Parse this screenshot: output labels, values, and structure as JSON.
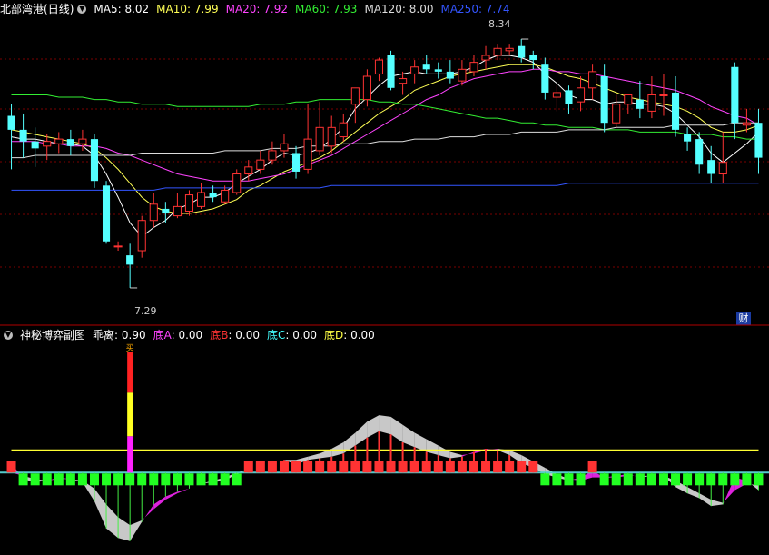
{
  "header": {
    "stock_name": "北部湾港",
    "period": "(日线)",
    "ma": [
      {
        "label": "MA5",
        "value": "8.02",
        "color": "#ffffff"
      },
      {
        "label": "MA10",
        "value": "7.99",
        "color": "#ffff55"
      },
      {
        "label": "MA20",
        "value": "7.92",
        "color": "#ff44ff"
      },
      {
        "label": "MA60",
        "value": "7.93",
        "color": "#33ee33"
      },
      {
        "label": "MA120",
        "value": "8.00",
        "color": "#dddddd"
      },
      {
        "label": "MA250",
        "value": "7.74",
        "color": "#3355ff"
      }
    ]
  },
  "sub_header": {
    "title": "神秘博弈副图",
    "items": [
      {
        "label": "乖离",
        "value": "0.90",
        "color": "#ffffff"
      },
      {
        "label": "底A",
        "value": "0.00",
        "color": "#ff44ff"
      },
      {
        "label": "底B",
        "value": "0.00",
        "color": "#ff3333"
      },
      {
        "label": "底C",
        "value": "0.00",
        "color": "#44ffff"
      },
      {
        "label": "底D",
        "value": "0.00",
        "color": "#ffff44"
      }
    ]
  },
  "annotations": {
    "high": "8.34",
    "low": "7.29",
    "badge": "财",
    "buy_marker": "买"
  },
  "colors": {
    "up": "#ff3333",
    "down": "#54ffff",
    "grid": "#7a0000",
    "bg": "#000000"
  },
  "chart_data": [
    {
      "type": "candlestick",
      "ylim": [
        7.2,
        8.45
      ],
      "candles": [
        [
          8.03,
          7.97,
          8.08,
          7.8
        ],
        [
          7.97,
          7.92,
          8.04,
          7.85
        ],
        [
          7.92,
          7.89,
          7.98,
          7.81
        ],
        [
          7.9,
          7.92,
          7.95,
          7.84
        ],
        [
          7.91,
          7.93,
          7.96,
          7.87
        ],
        [
          7.93,
          7.9,
          7.97,
          7.86
        ],
        [
          7.91,
          7.93,
          7.97,
          7.88
        ],
        [
          7.93,
          7.75,
          7.95,
          7.72
        ],
        [
          7.73,
          7.49,
          7.75,
          7.48
        ],
        [
          7.47,
          7.47,
          7.49,
          7.45
        ],
        [
          7.43,
          7.39,
          7.48,
          7.29
        ],
        [
          7.45,
          7.58,
          7.6,
          7.42
        ],
        [
          7.58,
          7.65,
          7.7,
          7.55
        ],
        [
          7.63,
          7.61,
          7.66,
          7.57
        ],
        [
          7.6,
          7.64,
          7.7,
          7.59
        ],
        [
          7.62,
          7.69,
          7.71,
          7.6
        ],
        [
          7.64,
          7.7,
          7.74,
          7.63
        ],
        [
          7.7,
          7.68,
          7.73,
          7.66
        ],
        [
          7.66,
          7.71,
          7.73,
          7.65
        ],
        [
          7.7,
          7.78,
          7.8,
          7.69
        ],
        [
          7.78,
          7.81,
          7.84,
          7.75
        ],
        [
          7.8,
          7.84,
          7.88,
          7.78
        ],
        [
          7.84,
          7.88,
          7.92,
          7.82
        ],
        [
          7.88,
          7.91,
          7.95,
          7.85
        ],
        [
          7.87,
          7.79,
          7.9,
          7.76
        ],
        [
          7.8,
          7.93,
          8.08,
          7.78
        ],
        [
          7.88,
          7.98,
          8.09,
          7.86
        ],
        [
          7.9,
          7.98,
          8.03,
          7.87
        ],
        [
          7.94,
          8.0,
          8.04,
          7.92
        ],
        [
          8.08,
          8.15,
          8.15,
          8.0
        ],
        [
          8.1,
          8.2,
          8.23,
          8.07
        ],
        [
          8.21,
          8.27,
          8.28,
          8.18
        ],
        [
          8.29,
          8.15,
          8.31,
          8.14
        ],
        [
          8.17,
          8.19,
          8.22,
          8.12
        ],
        [
          8.21,
          8.24,
          8.27,
          8.17
        ],
        [
          8.25,
          8.23,
          8.29,
          8.21
        ],
        [
          8.23,
          8.22,
          8.26,
          8.19
        ],
        [
          8.22,
          8.19,
          8.27,
          8.17
        ],
        [
          8.18,
          8.23,
          8.27,
          8.16
        ],
        [
          8.22,
          8.26,
          8.29,
          8.2
        ],
        [
          8.27,
          8.29,
          8.33,
          8.23
        ],
        [
          8.29,
          8.32,
          8.34,
          8.27
        ],
        [
          8.31,
          8.32,
          8.34,
          8.29
        ],
        [
          8.33,
          8.28,
          8.36,
          8.26
        ],
        [
          8.29,
          8.27,
          8.31,
          8.23
        ],
        [
          8.25,
          8.13,
          8.28,
          8.1
        ],
        [
          8.11,
          8.13,
          8.16,
          8.05
        ],
        [
          8.14,
          8.08,
          8.16,
          8.04
        ],
        [
          8.09,
          8.15,
          8.2,
          8.05
        ],
        [
          8.15,
          8.22,
          8.25,
          8.1
        ],
        [
          8.2,
          8.0,
          8.25,
          7.96
        ],
        [
          8.0,
          8.08,
          8.12,
          7.98
        ],
        [
          8.08,
          8.12,
          8.12,
          8.04
        ],
        [
          8.1,
          8.06,
          8.18,
          8.02
        ],
        [
          8.05,
          8.12,
          8.2,
          8.02
        ],
        [
          8.12,
          8.12,
          8.21,
          8.03
        ],
        [
          8.13,
          7.97,
          8.2,
          7.94
        ],
        [
          7.95,
          7.92,
          7.98,
          7.88
        ],
        [
          7.93,
          7.82,
          7.96,
          7.78
        ],
        [
          7.84,
          7.78,
          7.9,
          7.74
        ],
        [
          7.78,
          7.83,
          7.96,
          7.74
        ],
        [
          8.24,
          8.0,
          8.26,
          7.93
        ],
        [
          7.99,
          8.0,
          8.06,
          7.96
        ],
        [
          8.0,
          7.85,
          8.06,
          7.78
        ]
      ],
      "ma": {
        "MA5": [
          7.94,
          7.93,
          7.93,
          7.92,
          7.91,
          7.91,
          7.9,
          7.86,
          7.78,
          7.68,
          7.57,
          7.51,
          7.55,
          7.58,
          7.63,
          7.65,
          7.68,
          7.68,
          7.7,
          7.74,
          7.77,
          7.8,
          7.84,
          7.87,
          7.86,
          7.87,
          7.89,
          7.93,
          7.98,
          8.06,
          8.11,
          8.16,
          8.2,
          8.21,
          8.22,
          8.21,
          8.21,
          8.21,
          8.22,
          8.24,
          8.27,
          8.29,
          8.29,
          8.28,
          8.26,
          8.21,
          8.17,
          8.12,
          8.1,
          8.1,
          8.08,
          8.09,
          8.09,
          8.08,
          8.08,
          8.07,
          8.04,
          7.99,
          7.94,
          7.87,
          7.83,
          7.87,
          7.91,
          7.96
        ],
        "MA10": [
          7.97,
          7.96,
          7.95,
          7.94,
          7.93,
          7.92,
          7.91,
          7.89,
          7.85,
          7.8,
          7.74,
          7.68,
          7.64,
          7.62,
          7.61,
          7.61,
          7.62,
          7.63,
          7.65,
          7.67,
          7.71,
          7.73,
          7.76,
          7.79,
          7.81,
          7.83,
          7.85,
          7.88,
          7.92,
          7.96,
          8.0,
          8.04,
          8.07,
          8.1,
          8.14,
          8.16,
          8.18,
          8.2,
          8.21,
          8.22,
          8.23,
          8.24,
          8.25,
          8.25,
          8.25,
          8.24,
          8.22,
          8.2,
          8.19,
          8.17,
          8.15,
          8.13,
          8.11,
          8.1,
          8.09,
          8.08,
          8.07,
          8.05,
          8.02,
          7.98,
          7.96,
          7.96,
          7.97,
          7.99
        ],
        "MA20": [
          7.92,
          7.92,
          7.92,
          7.91,
          7.91,
          7.9,
          7.9,
          7.9,
          7.89,
          7.87,
          7.86,
          7.84,
          7.82,
          7.8,
          7.78,
          7.77,
          7.76,
          7.75,
          7.75,
          7.75,
          7.75,
          7.76,
          7.77,
          7.78,
          7.8,
          7.82,
          7.84,
          7.86,
          7.89,
          7.92,
          7.95,
          7.98,
          8.01,
          8.04,
          8.07,
          8.1,
          8.12,
          8.15,
          8.17,
          8.19,
          8.2,
          8.21,
          8.22,
          8.22,
          8.23,
          8.23,
          8.22,
          8.22,
          8.21,
          8.21,
          8.2,
          8.19,
          8.18,
          8.17,
          8.16,
          8.15,
          8.14,
          8.12,
          8.1,
          8.07,
          8.05,
          8.03,
          8.02,
          7.99
        ],
        "MA60": [
          8.12,
          8.12,
          8.12,
          8.12,
          8.11,
          8.11,
          8.11,
          8.1,
          8.1,
          8.09,
          8.09,
          8.08,
          8.08,
          8.08,
          8.07,
          8.07,
          8.07,
          8.07,
          8.07,
          8.07,
          8.07,
          8.08,
          8.08,
          8.08,
          8.09,
          8.09,
          8.1,
          8.1,
          8.1,
          8.1,
          8.1,
          8.09,
          8.09,
          8.08,
          8.08,
          8.07,
          8.06,
          8.05,
          8.04,
          8.03,
          8.02,
          8.02,
          8.01,
          8.0,
          8.0,
          7.99,
          7.99,
          7.98,
          7.98,
          7.98,
          7.97,
          7.97,
          7.97,
          7.96,
          7.96,
          7.96,
          7.96,
          7.95,
          7.95,
          7.95,
          7.94,
          7.94,
          7.93,
          7.93
        ],
        "MA120": [
          7.85,
          7.85,
          7.86,
          7.86,
          7.86,
          7.86,
          7.86,
          7.86,
          7.86,
          7.86,
          7.86,
          7.87,
          7.87,
          7.87,
          7.87,
          7.87,
          7.87,
          7.87,
          7.88,
          7.88,
          7.88,
          7.88,
          7.89,
          7.89,
          7.89,
          7.9,
          7.9,
          7.9,
          7.91,
          7.91,
          7.91,
          7.92,
          7.92,
          7.92,
          7.93,
          7.93,
          7.93,
          7.94,
          7.94,
          7.94,
          7.95,
          7.95,
          7.95,
          7.96,
          7.96,
          7.96,
          7.96,
          7.97,
          7.97,
          7.97,
          7.97,
          7.98,
          7.98,
          7.98,
          7.98,
          7.98,
          7.99,
          7.99,
          7.99,
          7.99,
          7.99,
          8.0,
          8.0,
          8.0
        ],
        "MA250": [
          7.71,
          7.71,
          7.71,
          7.71,
          7.71,
          7.71,
          7.71,
          7.71,
          7.71,
          7.71,
          7.71,
          7.71,
          7.71,
          7.72,
          7.72,
          7.72,
          7.72,
          7.72,
          7.72,
          7.72,
          7.72,
          7.72,
          7.72,
          7.72,
          7.72,
          7.72,
          7.72,
          7.73,
          7.73,
          7.73,
          7.73,
          7.73,
          7.73,
          7.73,
          7.73,
          7.73,
          7.73,
          7.73,
          7.73,
          7.73,
          7.73,
          7.73,
          7.73,
          7.73,
          7.73,
          7.73,
          7.73,
          7.74,
          7.74,
          7.74,
          7.74,
          7.74,
          7.74,
          7.74,
          7.74,
          7.74,
          7.74,
          7.74,
          7.74,
          7.74,
          7.74,
          7.74,
          7.74,
          7.74
        ]
      }
    },
    {
      "type": "bar",
      "ylim": [
        -1.0,
        1.6
      ],
      "yellow_line": [
        0.28,
        0.28,
        0.28,
        0.28,
        0.28,
        0.28,
        0.28,
        0.28,
        0.28,
        0.28,
        0.28,
        0.28,
        0.28,
        0.28,
        0.28,
        0.28,
        0.28,
        0.28,
        0.28,
        0.28,
        0.28,
        0.28,
        0.28,
        0.28,
        0.28,
        0.28,
        0.28,
        0.28,
        0.28,
        0.28,
        0.28,
        0.28,
        0.28,
        0.28,
        0.28,
        0.28,
        0.28,
        0.28,
        0.28,
        0.28,
        0.28,
        0.28,
        0.28,
        0.28,
        0.28,
        0.28,
        0.28,
        0.28,
        0.28,
        0.28,
        0.28,
        0.28,
        0.28,
        0.28,
        0.28,
        0.28,
        0.28,
        0.28,
        0.28,
        0.28,
        0.28,
        0.28,
        0.28,
        0.28
      ],
      "bias": [
        0.12,
        -0.08,
        -0.12,
        -0.1,
        -0.06,
        -0.08,
        -0.12,
        -0.36,
        -0.7,
        -0.82,
        -0.86,
        -0.62,
        -0.4,
        -0.3,
        -0.24,
        -0.2,
        -0.14,
        -0.12,
        -0.1,
        -0.02,
        0.04,
        0.08,
        0.12,
        0.16,
        0.1,
        0.16,
        0.18,
        0.2,
        0.24,
        0.34,
        0.44,
        0.52,
        0.48,
        0.38,
        0.32,
        0.26,
        0.22,
        0.18,
        0.2,
        0.26,
        0.3,
        0.28,
        0.22,
        0.12,
        0.06,
        -0.02,
        -0.06,
        -0.1,
        -0.06,
        0.02,
        -0.06,
        -0.04,
        -0.02,
        -0.06,
        -0.04,
        -0.04,
        -0.18,
        -0.26,
        -0.32,
        -0.42,
        -0.4,
        -0.06,
        -0.1,
        -0.22
      ],
      "signal": [
        0.0,
        -0.04,
        -0.08,
        -0.1,
        -0.08,
        -0.08,
        -0.1,
        -0.2,
        -0.4,
        -0.56,
        -0.66,
        -0.6,
        -0.46,
        -0.34,
        -0.26,
        -0.2,
        -0.14,
        -0.1,
        -0.06,
        0.0,
        0.04,
        0.08,
        0.12,
        0.16,
        0.16,
        0.2,
        0.24,
        0.3,
        0.38,
        0.5,
        0.64,
        0.72,
        0.7,
        0.6,
        0.5,
        0.42,
        0.34,
        0.26,
        0.22,
        0.24,
        0.28,
        0.3,
        0.28,
        0.22,
        0.14,
        0.06,
        -0.02,
        -0.08,
        -0.1,
        -0.06,
        -0.06,
        -0.06,
        -0.04,
        -0.04,
        -0.04,
        -0.04,
        -0.1,
        -0.18,
        -0.26,
        -0.34,
        -0.38,
        -0.22,
        -0.14,
        -0.16
      ],
      "buy_index": 10,
      "buy_height": 1.52
    }
  ]
}
